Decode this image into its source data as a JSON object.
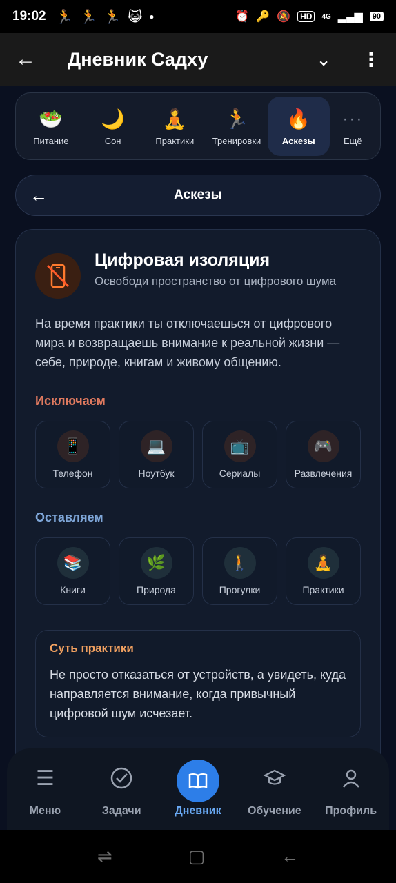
{
  "status_bar": {
    "time": "19:02",
    "network": "4G",
    "hd": "HD",
    "battery": "90"
  },
  "app_bar": {
    "title": "Дневник Садху"
  },
  "categories": [
    {
      "label": "Питание",
      "icon": "bowl-icon",
      "glyph": "🥗"
    },
    {
      "label": "Сон",
      "icon": "moon-icon",
      "glyph": "🌙"
    },
    {
      "label": "Практики",
      "icon": "meditation-icon",
      "glyph": "🧘"
    },
    {
      "label": "Тренировки",
      "icon": "running-icon",
      "glyph": "🏃"
    },
    {
      "label": "Аскезы",
      "icon": "fire-icon",
      "glyph": "🔥"
    },
    {
      "label": "Ещё",
      "icon": "more-dots-icon",
      "glyph": "···"
    }
  ],
  "section": {
    "title": "Аскезы"
  },
  "practice": {
    "title": "Цифровая изоляция",
    "subtitle": "Освободи пространство от цифрового шума",
    "description": "На время практики ты отключаешься от цифрового мира и возвращаешь внимание к реальной жизни — себе, природе, книгам и живому общению.",
    "exclude_title": "Исключаем",
    "exclude": [
      {
        "label": "Телефон",
        "icon": "phone-icon",
        "glyph": "📱"
      },
      {
        "label": "Ноутбук",
        "icon": "laptop-icon",
        "glyph": "💻"
      },
      {
        "label": "Сериалы",
        "icon": "tv-icon",
        "glyph": "📺"
      },
      {
        "label": "Развлечения",
        "icon": "gamepad-icon",
        "glyph": "🎮"
      }
    ],
    "keep_title": "Оставляем",
    "keep": [
      {
        "label": "Книги",
        "icon": "books-icon",
        "glyph": "📚"
      },
      {
        "label": "Природа",
        "icon": "leaf-icon",
        "glyph": "🌿"
      },
      {
        "label": "Прогулки",
        "icon": "walking-icon",
        "glyph": "🚶"
      },
      {
        "label": "Практики",
        "icon": "meditation-icon",
        "glyph": "🧘"
      }
    ],
    "essence_title": "Суть практики",
    "essence_text": "Не просто отказаться от устройств, а увидеть, куда направляется внимание, когда привычный цифровой шум исчезает."
  },
  "bottom_nav": [
    {
      "label": "Меню",
      "icon": "menu-icon",
      "glyph": "☰"
    },
    {
      "label": "Задачи",
      "icon": "check-circle-icon",
      "glyph": "✓"
    },
    {
      "label": "Дневник",
      "icon": "book-icon",
      "glyph": "📖"
    },
    {
      "label": "Обучение",
      "icon": "graduation-cap-icon",
      "glyph": "🎓"
    },
    {
      "label": "Профиль",
      "icon": "person-icon",
      "glyph": "👤"
    }
  ],
  "colors": {
    "accent_blue": "#2d7ee8",
    "exclude_title": "#e07a5f",
    "keep_title": "#7ea6d8",
    "essence_title": "#f0a060"
  }
}
